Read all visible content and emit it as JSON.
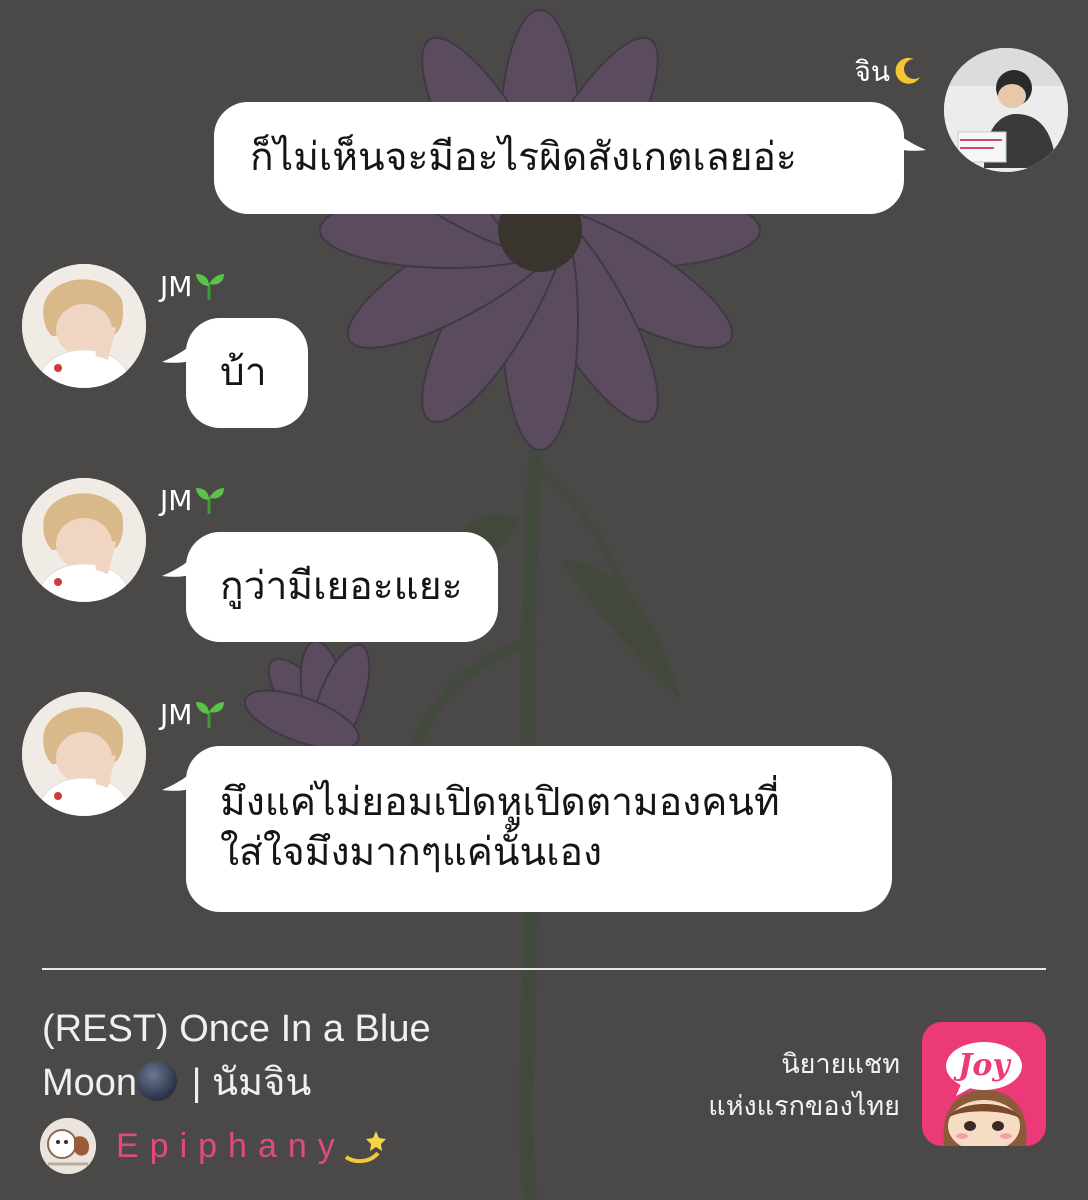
{
  "messages": [
    {
      "sender": "จิน",
      "sender_emoji": "crescent-moon",
      "side": "right",
      "text_lines": [
        "ก็ไม่เห็นจะมีอะไรผิดสังเกตเลยอ่ะ"
      ]
    },
    {
      "sender": "JM",
      "sender_emoji": "seedling",
      "side": "left",
      "text_lines": [
        "บ้า"
      ]
    },
    {
      "sender": "JM",
      "sender_emoji": "seedling",
      "side": "left",
      "text_lines": [
        "กูว่ามีเยอะแยะ"
      ]
    },
    {
      "sender": "JM",
      "sender_emoji": "seedling",
      "side": "left",
      "text_lines": [
        "มึงแค่ไม่ยอมเปิดหูเปิดตามองคนที่",
        "ใส่ใจมึงมากๆแค่นั้นเอง"
      ]
    }
  ],
  "footer": {
    "title_line1": "(REST) Once In a Blue",
    "title_line2_a": "Moon",
    "title_line2_b": " | นัมจิน",
    "author": "Epiphany",
    "author_emoji": "dizzy-star",
    "tagline_line1": "นิยายแชท",
    "tagline_line2": "แห่งแรกของไทย",
    "logo_text": "Joy"
  },
  "colors": {
    "background": "#4a4948",
    "bubble": "#ffffff",
    "text_white": "#ffffff",
    "author_pink": "#e04a82",
    "logo_pink": "#ec3a78"
  }
}
